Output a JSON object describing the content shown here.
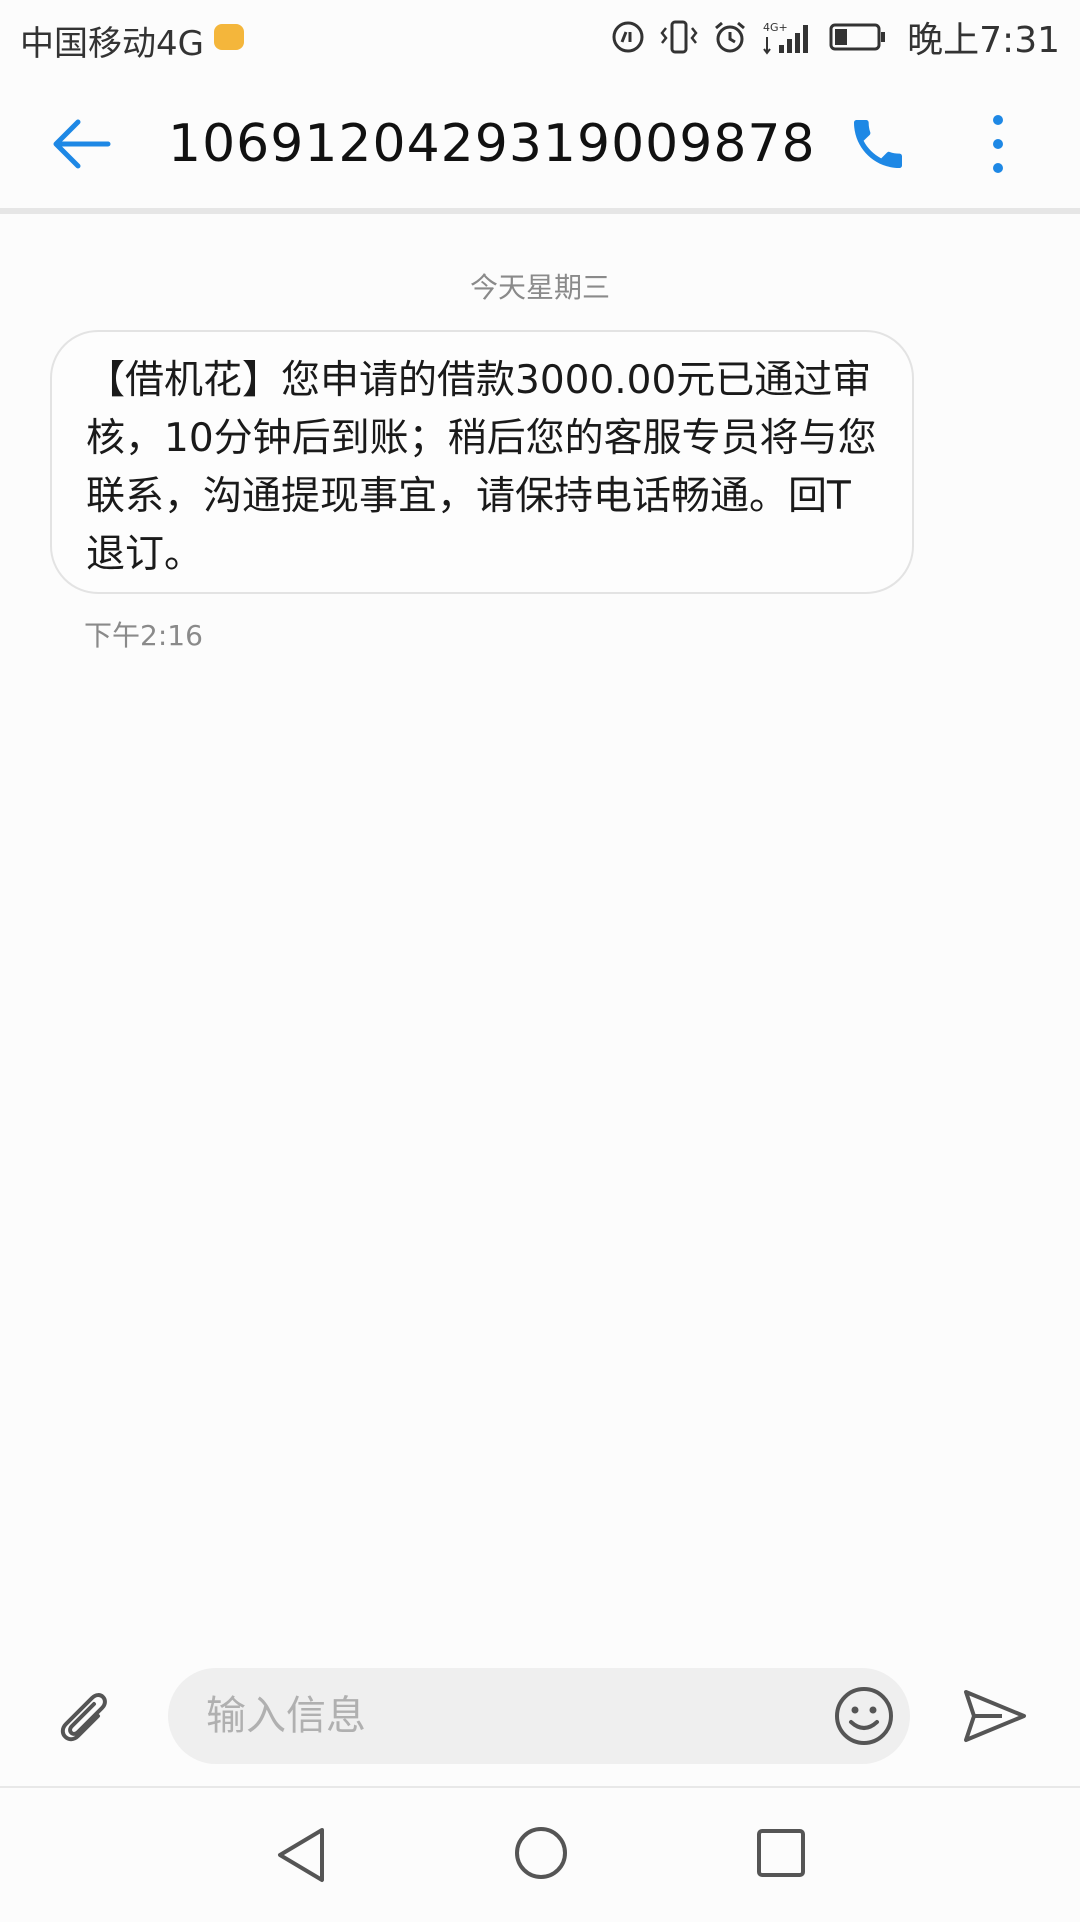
{
  "status_bar": {
    "carrier": "中国移动4G",
    "time": "晚上7:31",
    "icons": [
      "hd-call-icon",
      "vibrate-icon",
      "alarm-icon",
      "4g-signal-icon",
      "battery-icon"
    ],
    "battery_level": 0.3
  },
  "app_bar": {
    "title": "10691204293190098​78",
    "back_icon": "back-arrow-icon",
    "call_icon": "phone-icon",
    "more_icon": "more-vert-icon"
  },
  "conversation": {
    "date_separator": "今天星期三",
    "messages": [
      {
        "text": "【借机花】您申请的借款3000.00元已通过审核，10分钟后到账；稍后您的客服专员将与您联系，沟通提现事宜，请保持电话畅通。回T退订。",
        "time": "下午2:16"
      }
    ]
  },
  "input_bar": {
    "placeholder": "输入信息",
    "value": "",
    "attach_icon": "paperclip-icon",
    "emoji_icon": "smiley-icon",
    "send_icon": "send-icon"
  },
  "nav_bar": {
    "items": [
      "nav-back-icon",
      "nav-home-icon",
      "nav-recent-icon"
    ]
  },
  "colors": {
    "accent": "#1e88e5",
    "background": "#fcfcfc",
    "bubble_border": "#e3e3e3",
    "input_background": "#efefef"
  }
}
